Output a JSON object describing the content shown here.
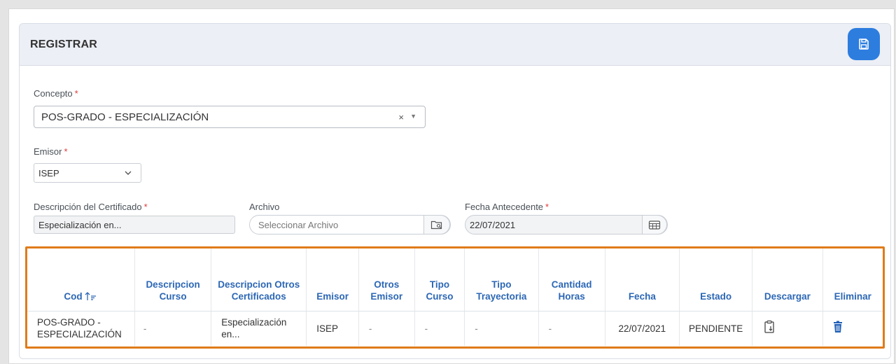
{
  "panel": {
    "title": "REGISTRAR",
    "save_icon": "save-icon"
  },
  "form": {
    "concepto": {
      "label": "Concepto",
      "required": "*",
      "value": "POS-GRADO - ESPECIALIZACIÓN",
      "clear": "×",
      "caret": "▼"
    },
    "emisor": {
      "label": "Emisor",
      "required": "*",
      "value": "ISEP"
    },
    "descripcion": {
      "label": "Descripción del Certificado",
      "required": "*",
      "value": "Especialización en..."
    },
    "archivo": {
      "label": "Archivo",
      "placeholder": "Seleccionar Archivo"
    },
    "fecha": {
      "label": "Fecha Antecedente",
      "required": "*",
      "value": "22/07/2021"
    }
  },
  "table": {
    "headers": {
      "cod": "Cod",
      "desc_curso": "Descripcion Curso",
      "desc_otros": "Descripcion Otros Certificados",
      "emisor": "Emisor",
      "otros_emisor": "Otros Emisor",
      "tipo_curso": "Tipo Curso",
      "tipo_trayectoria": "Tipo Trayectoria",
      "cantidad_horas": "Cantidad Horas",
      "fecha": "Fecha",
      "estado": "Estado",
      "descargar": "Descargar",
      "eliminar": "Eliminar"
    },
    "rows": [
      {
        "cod": "POS-GRADO - ESPECIALIZACIÓN",
        "desc_curso": "-",
        "desc_otros": "Especialización en...",
        "emisor": "ISEP",
        "otros_emisor": "-",
        "tipo_curso": "-",
        "tipo_trayectoria": "-",
        "cantidad_horas": "-",
        "fecha": "22/07/2021",
        "estado": "PENDIENTE"
      }
    ]
  },
  "colors": {
    "accent": "#2d7ddf",
    "header_text": "#2c67b5",
    "highlight": "#e07b1a",
    "required": "#e23b3b"
  }
}
